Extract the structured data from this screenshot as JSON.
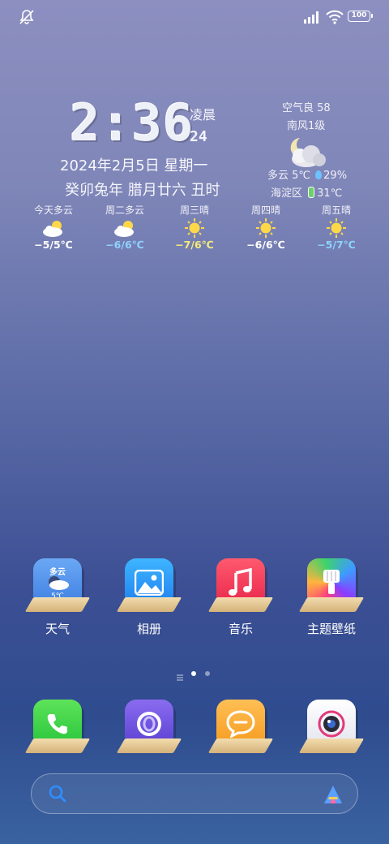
{
  "status_bar": {
    "battery": "100"
  },
  "clock": {
    "time": "2:36",
    "period": "凌晨",
    "seconds": "24"
  },
  "date": {
    "gregorian": "2024年2月5日  星期一",
    "lunar": "癸卯兔年  腊月廿六  丑时"
  },
  "weather_now": {
    "aqi": "空气良 58",
    "wind": "南风1级",
    "condition": "多云 5℃",
    "humidity": "29%",
    "location": "海淀区",
    "indoor_temp": "31℃"
  },
  "forecast": [
    {
      "label": "今天多云",
      "icon": "partly-cloudy-icon",
      "temp": "−5/5℃",
      "color": "#ffffff"
    },
    {
      "label": "周二多云",
      "icon": "partly-cloudy-icon",
      "temp": "−6/6℃",
      "color": "#8fd3ff"
    },
    {
      "label": "周三晴",
      "icon": "sunny-icon",
      "temp": "−7/6℃",
      "color": "#f6ec7a"
    },
    {
      "label": "周四晴",
      "icon": "sunny-icon",
      "temp": "−6/6℃",
      "color": "#ffffff"
    },
    {
      "label": "周五晴",
      "icon": "sunny-icon",
      "temp": "−5/7℃",
      "color": "#8fd3ff"
    }
  ],
  "apps": [
    {
      "name": "天气",
      "tile_text": "多云",
      "tile_temp": "5℃"
    },
    {
      "name": "相册"
    },
    {
      "name": "音乐"
    },
    {
      "name": "主题壁纸"
    }
  ],
  "page_indicator": {
    "count": 3,
    "current": 2
  }
}
